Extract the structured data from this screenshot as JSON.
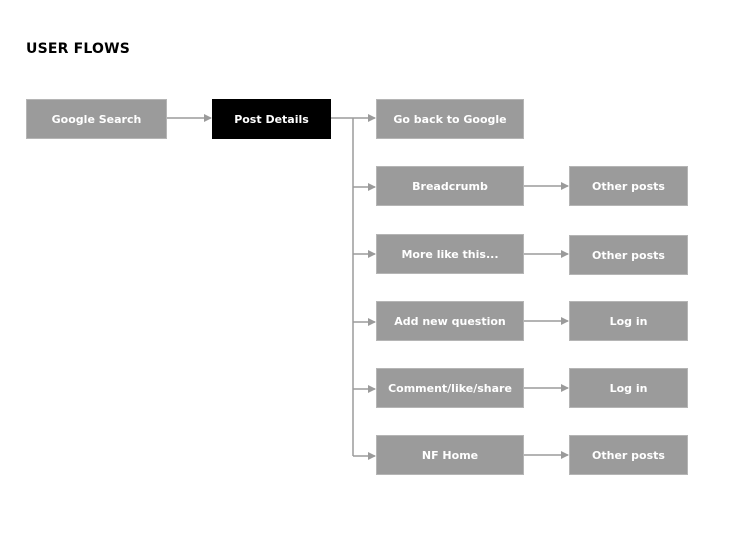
{
  "title": "USER FLOWS",
  "nodes": {
    "google_search": "Google Search",
    "post_details": "Post Details",
    "go_back_to_google": "Go back to Google",
    "breadcrumb": "Breadcrumb",
    "more_like_this": "More like this...",
    "add_new_question": "Add new question",
    "comment_like_share": "Comment/like/share",
    "nf_home": "NF Home",
    "breadcrumb_target": "Other posts",
    "more_like_this_target": "Other posts",
    "add_new_question_target": "Log in",
    "comment_like_share_target": "Log in",
    "nf_home_target": "Other posts"
  },
  "colors": {
    "node_fill": "#9b9b9b",
    "highlight_fill": "#000000",
    "connector": "#9b9b9b"
  }
}
